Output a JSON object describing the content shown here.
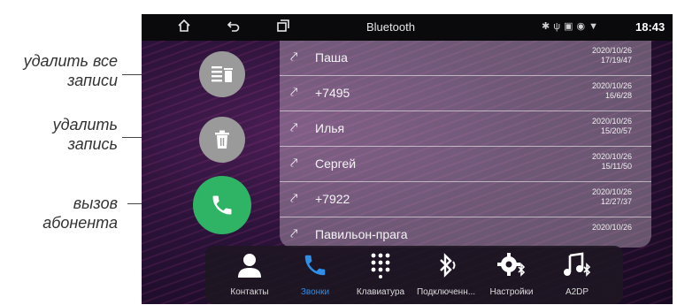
{
  "annotations": {
    "delete_all": [
      "удалить все",
      "записи"
    ],
    "delete_one": [
      "удалить",
      "запись"
    ],
    "call": [
      "вызов",
      "абонента"
    ]
  },
  "statusbar": {
    "title": "Bluetooth",
    "time": "18:43",
    "icons": [
      "home-icon",
      "back-icon",
      "recent-apps-icon",
      "bluetooth-icon",
      "usb-icon",
      "sd-card-icon",
      "location-icon",
      "wifi-icon"
    ]
  },
  "call_log": [
    {
      "name": "Паша",
      "date": "2020/10/26",
      "time": "17/19/47",
      "icon": "missed-call-icon"
    },
    {
      "name": "+7495",
      "date": "2020/10/26",
      "time": "16/6/28",
      "icon": "missed-call-icon"
    },
    {
      "name": "Илья",
      "date": "2020/10/26",
      "time": "15/20/57",
      "icon": "missed-call-icon"
    },
    {
      "name": "Сергей",
      "date": "2020/10/26",
      "time": "15/11/50",
      "icon": "missed-call-icon"
    },
    {
      "name": "+7922",
      "date": "2020/10/26",
      "time": "12/27/37",
      "icon": "missed-call-icon"
    },
    {
      "name": "Павильон-прага",
      "date": "2020/10/26",
      "time": "",
      "icon": "missed-call-icon"
    }
  ],
  "dock": [
    {
      "label": "Контакты",
      "icon": "contacts-icon",
      "active": false
    },
    {
      "label": "Звонки",
      "icon": "calls-icon",
      "active": true
    },
    {
      "label": "Клавиатура",
      "icon": "keypad-icon",
      "active": false
    },
    {
      "label": "Подключенн...",
      "icon": "bluetooth-connect-icon",
      "active": false
    },
    {
      "label": "Настройки",
      "icon": "settings-icon",
      "active": false
    },
    {
      "label": "A2DP",
      "icon": "a2dp-music-icon",
      "active": false
    }
  ],
  "colors": {
    "accent": "#2e8ee8",
    "call_green": "#2fb364",
    "button_grey": "#9a9a9a"
  }
}
